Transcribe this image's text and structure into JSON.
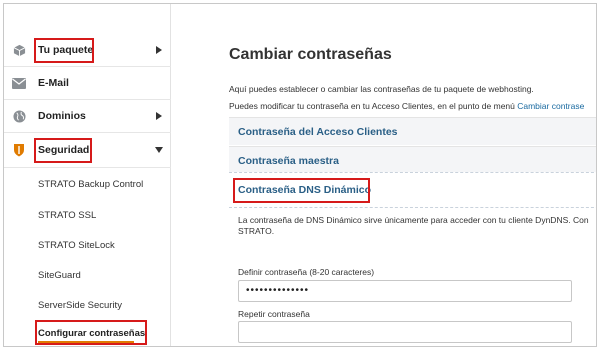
{
  "sidebar": {
    "items": [
      {
        "label": "Tu paquete",
        "icon": "package-icon",
        "arrow": "right"
      },
      {
        "label": "E-Mail",
        "icon": "mail-icon",
        "arrow": ""
      },
      {
        "label": "Dominios",
        "icon": "globe-icon",
        "arrow": "right"
      },
      {
        "label": "Seguridad",
        "icon": "shield-icon",
        "arrow": "down"
      }
    ],
    "subitems": [
      {
        "label": "STRATO Backup Control"
      },
      {
        "label": "STRATO SSL"
      },
      {
        "label": "STRATO SiteLock"
      },
      {
        "label": "SiteGuard"
      },
      {
        "label": "ServerSide Security"
      },
      {
        "label": "Configurar contraseñas"
      }
    ]
  },
  "main": {
    "title": "Cambiar contraseñas",
    "intro_line1": "Aquí puedes establecer o cambiar las contraseñas de tu paquete de webhosting.",
    "intro_line2_text": "Puedes modificar tu contraseña en tu Acceso Clientes, en el punto de menú ",
    "intro_line2_link": "Cambiar contrase",
    "accordions": [
      {
        "label": "Contraseña del Acceso Clientes"
      },
      {
        "label": "Contraseña maestra"
      },
      {
        "label": "Contraseña DNS Dinámico"
      }
    ],
    "dns_desc_line1": "La contraseña de DNS Dinámico sirve únicamente para acceder con tu cliente DynDNS. Con",
    "dns_desc_line2": "STRATO.",
    "define_label": "Definir contraseña (8-20 caracteres)",
    "define_value": "••••••••••••••",
    "repeat_label": "Repetir contraseña",
    "repeat_value": ""
  },
  "colors": {
    "highlight": "#d61a1a",
    "accordion_text": "#2a5f86",
    "link": "#1a6aa0",
    "shield": "#e07b00"
  }
}
